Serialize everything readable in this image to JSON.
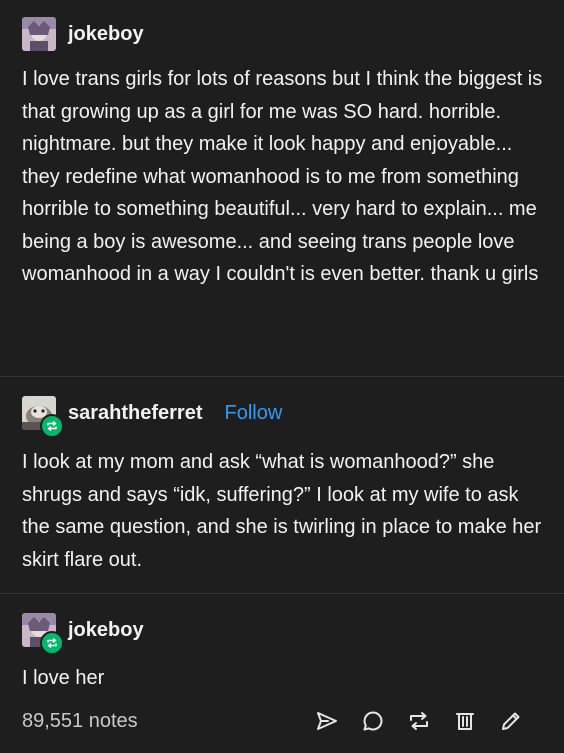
{
  "posts": [
    {
      "username": "jokeboy",
      "text": "I love trans girls for lots of reasons but I think the biggest is that growing up as a girl for me was SO hard. horrible. nightmare. but they make it look happy and enjoyable... they redefine what womanhood is to me from something horrible to something beautiful... very hard to explain... me being a boy is awesome... and seeing trans people love womanhood in a way I couldn't is even better. thank u girls"
    },
    {
      "username": "sarahtheferret",
      "follow_label": "Follow",
      "text": "I look at my mom and ask “what is womanhood?” she shrugs and says “idk, suffering?”  I look at my wife to ask the same question, and she is twirling in place to make her skirt flare out."
    },
    {
      "username": "jokeboy",
      "text": "I love her"
    }
  ],
  "footer": {
    "notes": "89,551 notes"
  },
  "icons": {
    "share": "paper-plane-icon",
    "reply": "speech-bubble-icon",
    "reblog": "reblog-icon",
    "delete": "trash-icon",
    "edit": "pencil-icon"
  },
  "colors": {
    "background": "#1e1e1f",
    "text": "#f2f2f2",
    "follow": "#2d9cf2",
    "reblog_badge": "#00b86b",
    "notes": "#c9c9c9"
  }
}
